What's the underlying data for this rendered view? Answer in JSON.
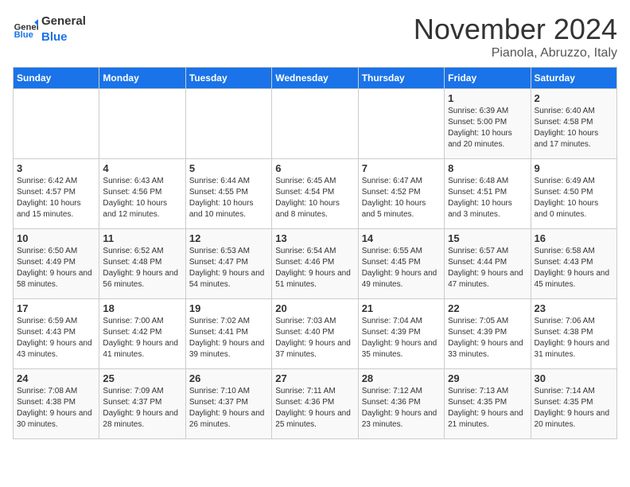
{
  "header": {
    "logo_general": "General",
    "logo_blue": "Blue",
    "title": "November 2024",
    "location": "Pianola, Abruzzo, Italy"
  },
  "calendar": {
    "weekdays": [
      "Sunday",
      "Monday",
      "Tuesday",
      "Wednesday",
      "Thursday",
      "Friday",
      "Saturday"
    ],
    "weeks": [
      [
        {
          "day": "",
          "info": ""
        },
        {
          "day": "",
          "info": ""
        },
        {
          "day": "",
          "info": ""
        },
        {
          "day": "",
          "info": ""
        },
        {
          "day": "",
          "info": ""
        },
        {
          "day": "1",
          "info": "Sunrise: 6:39 AM\nSunset: 5:00 PM\nDaylight: 10 hours\nand 20 minutes."
        },
        {
          "day": "2",
          "info": "Sunrise: 6:40 AM\nSunset: 4:58 PM\nDaylight: 10 hours\nand 17 minutes."
        }
      ],
      [
        {
          "day": "3",
          "info": "Sunrise: 6:42 AM\nSunset: 4:57 PM\nDaylight: 10 hours\nand 15 minutes."
        },
        {
          "day": "4",
          "info": "Sunrise: 6:43 AM\nSunset: 4:56 PM\nDaylight: 10 hours\nand 12 minutes."
        },
        {
          "day": "5",
          "info": "Sunrise: 6:44 AM\nSunset: 4:55 PM\nDaylight: 10 hours\nand 10 minutes."
        },
        {
          "day": "6",
          "info": "Sunrise: 6:45 AM\nSunset: 4:54 PM\nDaylight: 10 hours\nand 8 minutes."
        },
        {
          "day": "7",
          "info": "Sunrise: 6:47 AM\nSunset: 4:52 PM\nDaylight: 10 hours\nand 5 minutes."
        },
        {
          "day": "8",
          "info": "Sunrise: 6:48 AM\nSunset: 4:51 PM\nDaylight: 10 hours\nand 3 minutes."
        },
        {
          "day": "9",
          "info": "Sunrise: 6:49 AM\nSunset: 4:50 PM\nDaylight: 10 hours\nand 0 minutes."
        }
      ],
      [
        {
          "day": "10",
          "info": "Sunrise: 6:50 AM\nSunset: 4:49 PM\nDaylight: 9 hours\nand 58 minutes."
        },
        {
          "day": "11",
          "info": "Sunrise: 6:52 AM\nSunset: 4:48 PM\nDaylight: 9 hours\nand 56 minutes."
        },
        {
          "day": "12",
          "info": "Sunrise: 6:53 AM\nSunset: 4:47 PM\nDaylight: 9 hours\nand 54 minutes."
        },
        {
          "day": "13",
          "info": "Sunrise: 6:54 AM\nSunset: 4:46 PM\nDaylight: 9 hours\nand 51 minutes."
        },
        {
          "day": "14",
          "info": "Sunrise: 6:55 AM\nSunset: 4:45 PM\nDaylight: 9 hours\nand 49 minutes."
        },
        {
          "day": "15",
          "info": "Sunrise: 6:57 AM\nSunset: 4:44 PM\nDaylight: 9 hours\nand 47 minutes."
        },
        {
          "day": "16",
          "info": "Sunrise: 6:58 AM\nSunset: 4:43 PM\nDaylight: 9 hours\nand 45 minutes."
        }
      ],
      [
        {
          "day": "17",
          "info": "Sunrise: 6:59 AM\nSunset: 4:43 PM\nDaylight: 9 hours\nand 43 minutes."
        },
        {
          "day": "18",
          "info": "Sunrise: 7:00 AM\nSunset: 4:42 PM\nDaylight: 9 hours\nand 41 minutes."
        },
        {
          "day": "19",
          "info": "Sunrise: 7:02 AM\nSunset: 4:41 PM\nDaylight: 9 hours\nand 39 minutes."
        },
        {
          "day": "20",
          "info": "Sunrise: 7:03 AM\nSunset: 4:40 PM\nDaylight: 9 hours\nand 37 minutes."
        },
        {
          "day": "21",
          "info": "Sunrise: 7:04 AM\nSunset: 4:39 PM\nDaylight: 9 hours\nand 35 minutes."
        },
        {
          "day": "22",
          "info": "Sunrise: 7:05 AM\nSunset: 4:39 PM\nDaylight: 9 hours\nand 33 minutes."
        },
        {
          "day": "23",
          "info": "Sunrise: 7:06 AM\nSunset: 4:38 PM\nDaylight: 9 hours\nand 31 minutes."
        }
      ],
      [
        {
          "day": "24",
          "info": "Sunrise: 7:08 AM\nSunset: 4:38 PM\nDaylight: 9 hours\nand 30 minutes."
        },
        {
          "day": "25",
          "info": "Sunrise: 7:09 AM\nSunset: 4:37 PM\nDaylight: 9 hours\nand 28 minutes."
        },
        {
          "day": "26",
          "info": "Sunrise: 7:10 AM\nSunset: 4:37 PM\nDaylight: 9 hours\nand 26 minutes."
        },
        {
          "day": "27",
          "info": "Sunrise: 7:11 AM\nSunset: 4:36 PM\nDaylight: 9 hours\nand 25 minutes."
        },
        {
          "day": "28",
          "info": "Sunrise: 7:12 AM\nSunset: 4:36 PM\nDaylight: 9 hours\nand 23 minutes."
        },
        {
          "day": "29",
          "info": "Sunrise: 7:13 AM\nSunset: 4:35 PM\nDaylight: 9 hours\nand 21 minutes."
        },
        {
          "day": "30",
          "info": "Sunrise: 7:14 AM\nSunset: 4:35 PM\nDaylight: 9 hours\nand 20 minutes."
        }
      ]
    ]
  }
}
